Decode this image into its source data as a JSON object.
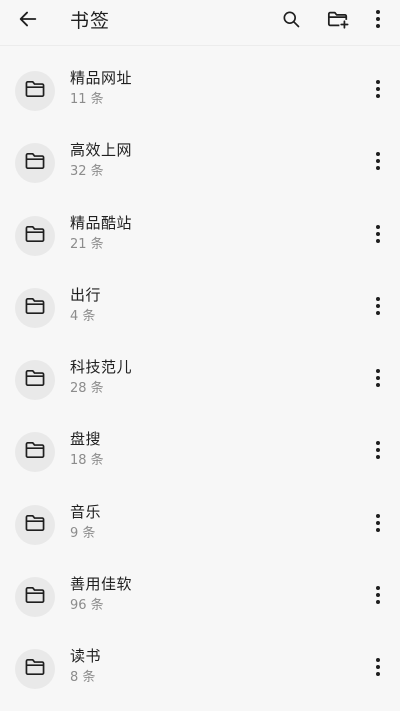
{
  "header": {
    "title": "书签",
    "icons": {
      "back": "arrow-left-icon",
      "search": "search-icon",
      "new_folder": "folder-add-icon",
      "more": "more-vertical-icon"
    }
  },
  "bookmarks": [
    {
      "name": "精品网址",
      "count": "11 条"
    },
    {
      "name": "高效上网",
      "count": "32 条"
    },
    {
      "name": "精品酷站",
      "count": "21 条"
    },
    {
      "name": "出行",
      "count": "4 条"
    },
    {
      "name": "科技范儿",
      "count": "28 条"
    },
    {
      "name": "盘搜",
      "count": "18 条"
    },
    {
      "name": "音乐",
      "count": "9 条"
    },
    {
      "name": "善用佳软",
      "count": "96 条"
    },
    {
      "name": "读书",
      "count": "8 条"
    }
  ],
  "colors": {
    "background": "#f7f7f7",
    "folder_circle": "#e9e9e9",
    "text_primary": "#202020",
    "text_secondary": "#8c8c8c"
  }
}
